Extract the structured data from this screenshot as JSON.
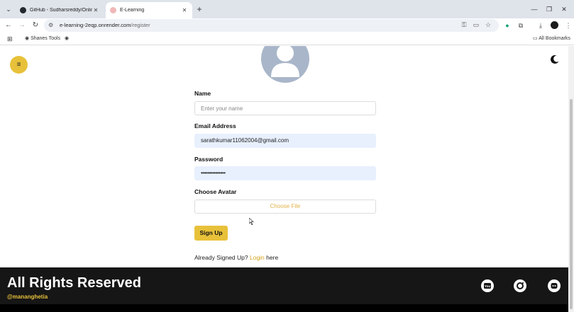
{
  "browser": {
    "tabs": [
      {
        "title": "GitHub - Sudharsreddy/Online",
        "active": false
      },
      {
        "title": "E-Learning",
        "active": true
      }
    ],
    "url_host": "e-learning-2eqp.onrender.com",
    "url_path": "/register",
    "bookmarks": [
      {
        "label": "Shanes Tools"
      }
    ],
    "all_bookmarks_label": "All Bookmarks"
  },
  "page": {
    "form": {
      "name_label": "Name",
      "name_placeholder": "Enter your name",
      "email_label": "Email Address",
      "email_value": "sarathkumar11062004@gmail.com",
      "password_label": "Password",
      "password_value": "•••••••••••••••",
      "avatar_label": "Choose Avatar",
      "choose_file_label": "Choose File",
      "submit_label": "Sign Up"
    },
    "already_text": "Already Signed Up?",
    "login_link": "Login",
    "already_suffix": "here"
  },
  "footer": {
    "title": "All Rights Reserved",
    "handle": "@mananghetia",
    "social_icons": [
      "youtube-icon",
      "instagram-icon",
      "github-icon"
    ]
  },
  "colors": {
    "accent": "#e8c13a",
    "footer_bg": "#161616",
    "autofill_bg": "#e8f0fe"
  }
}
